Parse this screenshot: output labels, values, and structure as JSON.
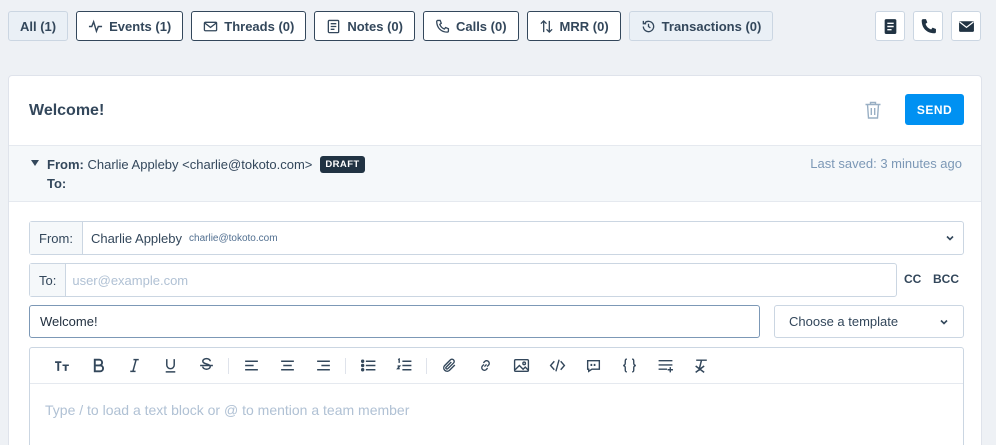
{
  "filters": [
    {
      "id": "all",
      "label": "All (1)",
      "icon": "none",
      "active": true
    },
    {
      "id": "events",
      "label": "Events (1)",
      "icon": "activity-icon",
      "active": false
    },
    {
      "id": "threads",
      "label": "Threads (0)",
      "icon": "mail-icon",
      "active": false
    },
    {
      "id": "notes",
      "label": "Notes (0)",
      "icon": "note-icon",
      "active": false
    },
    {
      "id": "calls",
      "label": "Calls (0)",
      "icon": "phone-icon",
      "active": false
    },
    {
      "id": "mrr",
      "label": "MRR (0)",
      "icon": "arrows-updown-icon",
      "active": false
    },
    {
      "id": "transactions",
      "label": "Transactions (0)",
      "icon": "history-icon",
      "active": true
    }
  ],
  "actions": [
    "note-icon",
    "phone-icon",
    "mail-icon"
  ],
  "composer": {
    "title": "Welcome!",
    "send_label": "SEND",
    "meta": {
      "from_label": "From:",
      "from_value": "Charlie Appleby <charlie@tokoto.com>",
      "draft_badge": "DRAFT",
      "to_label": "To:",
      "last_saved": "Last saved: 3 minutes ago"
    },
    "from_field": {
      "label": "From:",
      "name": "Charlie Appleby",
      "email": "charlie@tokoto.com"
    },
    "to_field": {
      "label": "To:",
      "placeholder": "user@example.com",
      "value": ""
    },
    "cc_label": "CC",
    "bcc_label": "BCC",
    "subject": "Welcome!",
    "template_label": "Choose a template",
    "body_placeholder": "Type / to load a text block or @ to mention a team member"
  },
  "toolbar": [
    "text-size-icon",
    "bold-icon",
    "italic-icon",
    "underline-icon",
    "strikethrough-icon",
    "|",
    "align-left-icon",
    "align-center-icon",
    "align-right-icon",
    "|",
    "bullet-list-icon",
    "numbered-list-icon",
    "|",
    "attachment-icon",
    "link-icon",
    "image-icon",
    "code-icon",
    "quote-icon",
    "braces-icon",
    "insert-line-icon",
    "clear-format-icon"
  ],
  "colors": {
    "primary": "#0091f2",
    "dark": "#33475b",
    "badge": "#213343",
    "muted": "#7c98b6"
  }
}
